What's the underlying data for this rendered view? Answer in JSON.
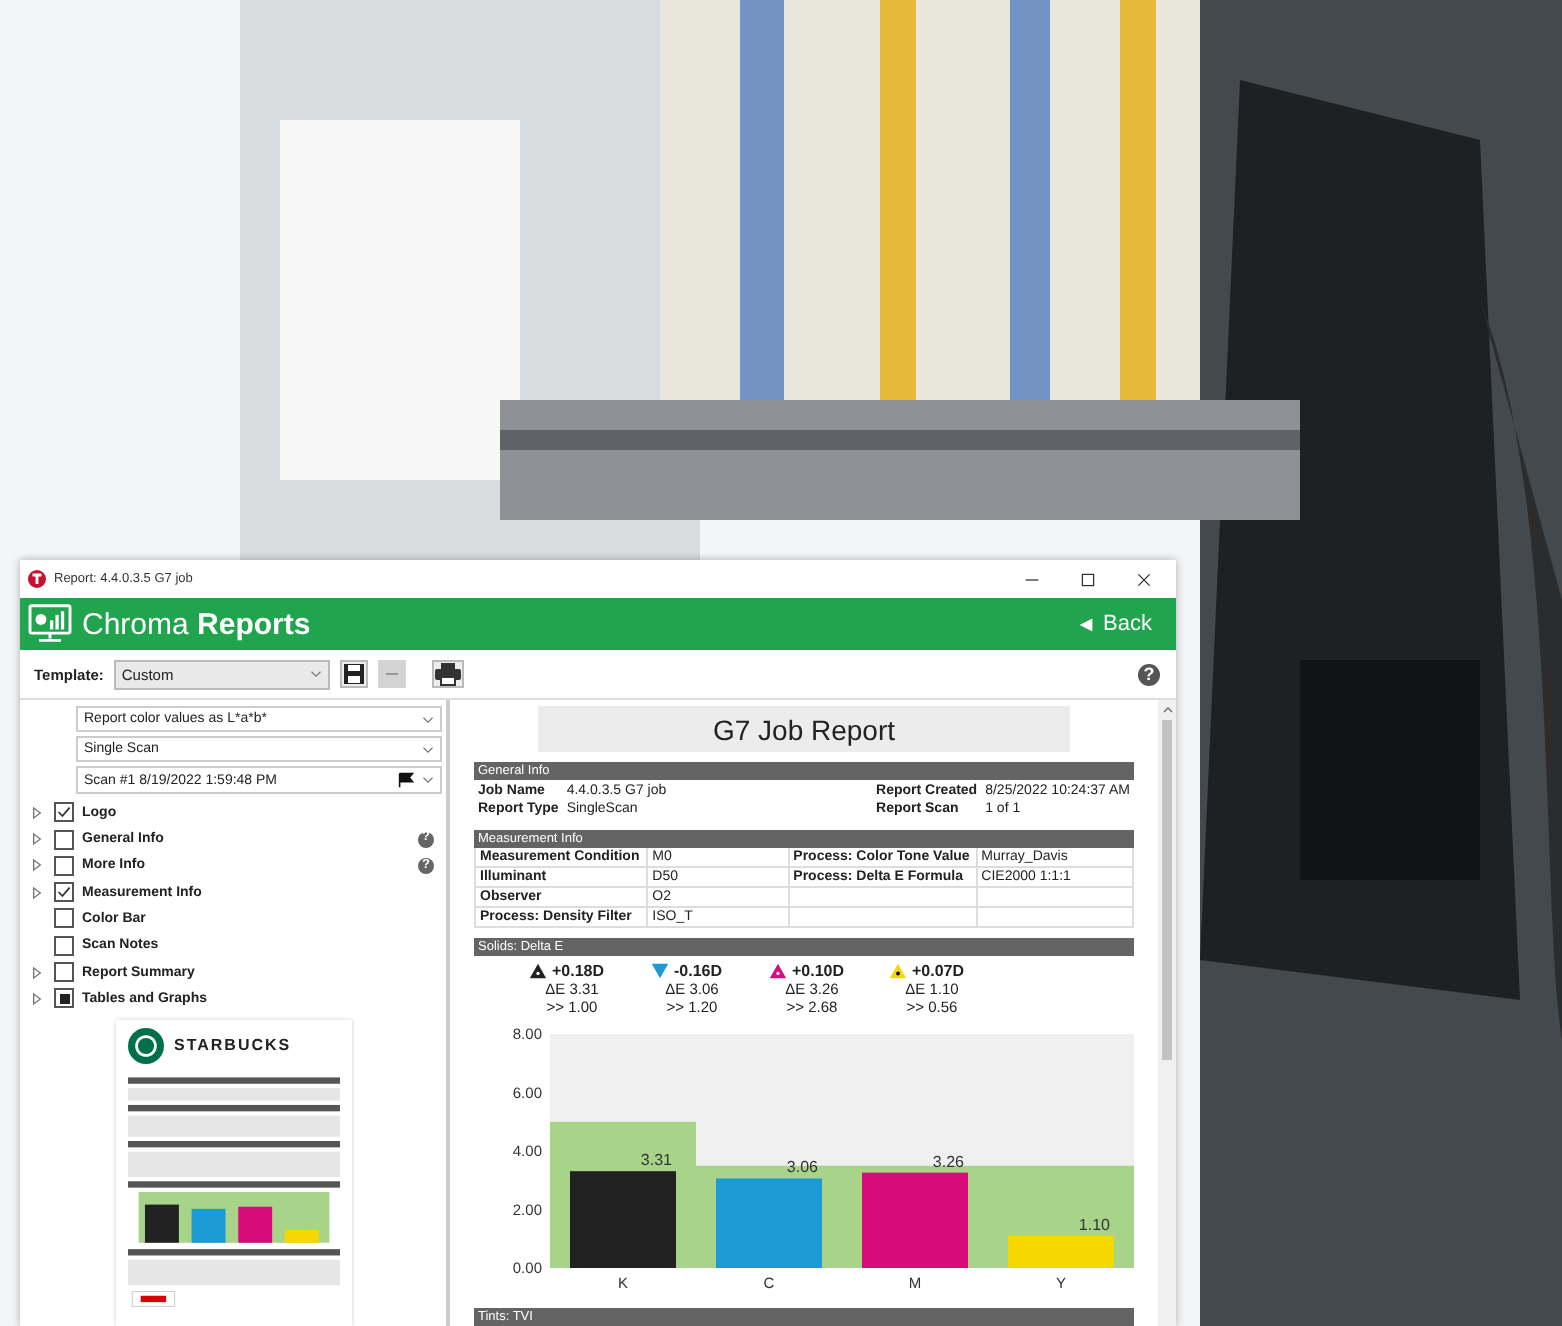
{
  "window": {
    "title": "Report: 4.4.0.3.5 G7 job"
  },
  "header": {
    "app_name": "Chroma **Reports**",
    "back": "Back"
  },
  "toolbar": {
    "template_label": "Template:",
    "template_value": "Custom",
    "remove_disabled": true,
    "help": "?"
  },
  "options": {
    "selects": [
      "Report color values as L*a*b*",
      "Single Scan",
      "Scan #1 8/19/2022 1:59:48 PM"
    ],
    "items": [
      {
        "label": "Logo",
        "expandable": true,
        "checked": true,
        "indeterminate": false
      },
      {
        "label": "General Info",
        "expandable": true,
        "checked": false,
        "indeterminate": false,
        "help": "?"
      },
      {
        "label": "More Info",
        "expandable": true,
        "checked": false,
        "indeterminate": false,
        "help": "?"
      },
      {
        "label": "Measurement Info",
        "expandable": true,
        "checked": true,
        "indeterminate": false
      },
      {
        "label": "Color Bar",
        "expandable": false,
        "checked": false,
        "indeterminate": false
      },
      {
        "label": "Scan Notes",
        "expandable": false,
        "checked": false,
        "indeterminate": false
      },
      {
        "label": "Report Summary",
        "expandable": true,
        "checked": false,
        "indeterminate": false
      },
      {
        "label": "Tables and Graphs",
        "expandable": true,
        "checked": true,
        "indeterminate": true
      }
    ],
    "preview": {
      "logo_text": "STARBUCKS"
    }
  },
  "report": {
    "title": "G7 Job Report",
    "general_info": {
      "heading": "General Info",
      "rows": [
        [
          "Job Name",
          "4.4.0.3.5 G7 job",
          "Report Created",
          "8/25/2022 10:24:37 AM"
        ],
        [
          "Report Type",
          "SingleScan",
          "Report Scan",
          "1 of 1"
        ]
      ]
    },
    "measurement_info": {
      "heading": "Measurement Info",
      "rows": [
        [
          "Measurement Condition",
          "M0",
          "Process: Color Tone Value",
          "Murray_Davis"
        ],
        [
          "Illuminant",
          "D50",
          "Process: Delta E Formula",
          "CIE2000 1:1:1"
        ],
        [
          "Observer",
          "O2",
          "",
          ""
        ],
        [
          "Process: Density Filter",
          "ISO_T",
          "",
          ""
        ]
      ]
    },
    "solids": {
      "heading": "Solids: Delta E",
      "patches": [
        {
          "kind": "up",
          "color": "#222222",
          "density": "+0.18D",
          "delta_e": "ΔE 3.31",
          "target": ">> 1.00"
        },
        {
          "kind": "down",
          "color": "#1c9ad6",
          "density": "-0.16D",
          "delta_e": "ΔE 3.06",
          "target": ">> 1.20"
        },
        {
          "kind": "up",
          "color": "#d80b7a",
          "density": "+0.10D",
          "delta_e": "ΔE 3.26",
          "target": ">> 2.68"
        },
        {
          "kind": "dot",
          "color": "#f5d800",
          "density": "+0.07D",
          "delta_e": "ΔE 1.10",
          "target": ">> 0.56"
        }
      ],
      "chart_data": {
        "type": "bar",
        "categories": [
          "K",
          "C",
          "M",
          "Y"
        ],
        "series": [
          {
            "colors": [
              "#222222",
              "#1c9ad6",
              "#d80b7a",
              "#f5d800"
            ],
            "values": [
              3.31,
              3.06,
              3.26,
              1.1
            ]
          }
        ],
        "ylim": [
          0,
          8
        ],
        "yticks": [
          {
            "value": 0,
            "label": "0.00"
          },
          {
            "value": 2,
            "label": "2.00"
          },
          {
            "value": 4,
            "label": "4.00"
          },
          {
            "value": 6,
            "label": "6.00"
          },
          {
            "value": 8,
            "label": "8.00"
          }
        ],
        "value_labels": [
          "3.31",
          "3.06",
          "3.26",
          "1.10"
        ]
      }
    },
    "tints_heading": "Tints: TVI"
  }
}
